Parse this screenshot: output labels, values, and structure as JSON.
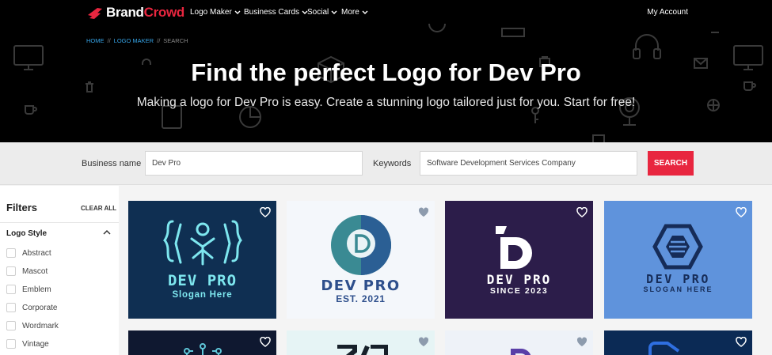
{
  "nav": {
    "brand_part1": "Brand",
    "brand_part2": "Crowd",
    "items": [
      {
        "label": "Logo Maker"
      },
      {
        "label": "Business Cards"
      },
      {
        "label": "Social"
      },
      {
        "label": "More"
      }
    ],
    "account_label": "My Account"
  },
  "breadcrumb": {
    "home": "HOME",
    "sep": "//",
    "logo_maker": "LOGO MAKER",
    "current": "SEARCH"
  },
  "hero": {
    "title": "Find the perfect Logo for Dev Pro",
    "subtitle": "Making a logo for Dev Pro is easy. Create a stunning logo tailored just for you. Start for free!"
  },
  "search": {
    "business_label": "Business name",
    "business_value": "Dev Pro",
    "keywords_label": "Keywords",
    "keywords_value": "Software Development Services Company",
    "button_label": "SEARCH"
  },
  "filters": {
    "title": "Filters",
    "clear_all": "CLEAR ALL",
    "section_title": "Logo Style",
    "options": [
      "Abstract",
      "Mascot",
      "Emblem",
      "Corporate",
      "Wordmark",
      "Vintage"
    ]
  },
  "logos": [
    {
      "name": "DEV PRO",
      "slogan": "Slogan Here",
      "bg": "#0f2f52",
      "fg": "#7ee7ef",
      "slogan_color": "#7ee7ef"
    },
    {
      "name": "DEV PRO",
      "slogan": "EST. 2021",
      "bg": "#f4f7fb",
      "fg": "#2e4f8c",
      "slogan_color": "#2e4f8c"
    },
    {
      "name": "DEV PRO",
      "slogan": "SINCE 2023",
      "bg": "#2c1d4a",
      "fg": "#ffffff",
      "slogan_color": "#ffffff"
    },
    {
      "name": "DEV PRO",
      "slogan": "SLOGAN HERE",
      "bg": "#5f93dc",
      "fg": "#162c58",
      "slogan_color": "#162c58"
    },
    {
      "name": "",
      "slogan": "",
      "bg": "#0f1830",
      "fg": "#5fc7d9"
    },
    {
      "name": "",
      "slogan": "",
      "bg": "#e6f4f5",
      "fg": "#17202a"
    },
    {
      "name": "",
      "slogan": "",
      "bg": "#eef2f8",
      "fg": "#5a3fa8"
    },
    {
      "name": "",
      "slogan": "",
      "bg": "#0b2a55",
      "fg": "#2f6fe0"
    }
  ],
  "colors": {
    "accent": "#e8263f",
    "link": "#36a3e6",
    "hero_bg": "#000000"
  }
}
